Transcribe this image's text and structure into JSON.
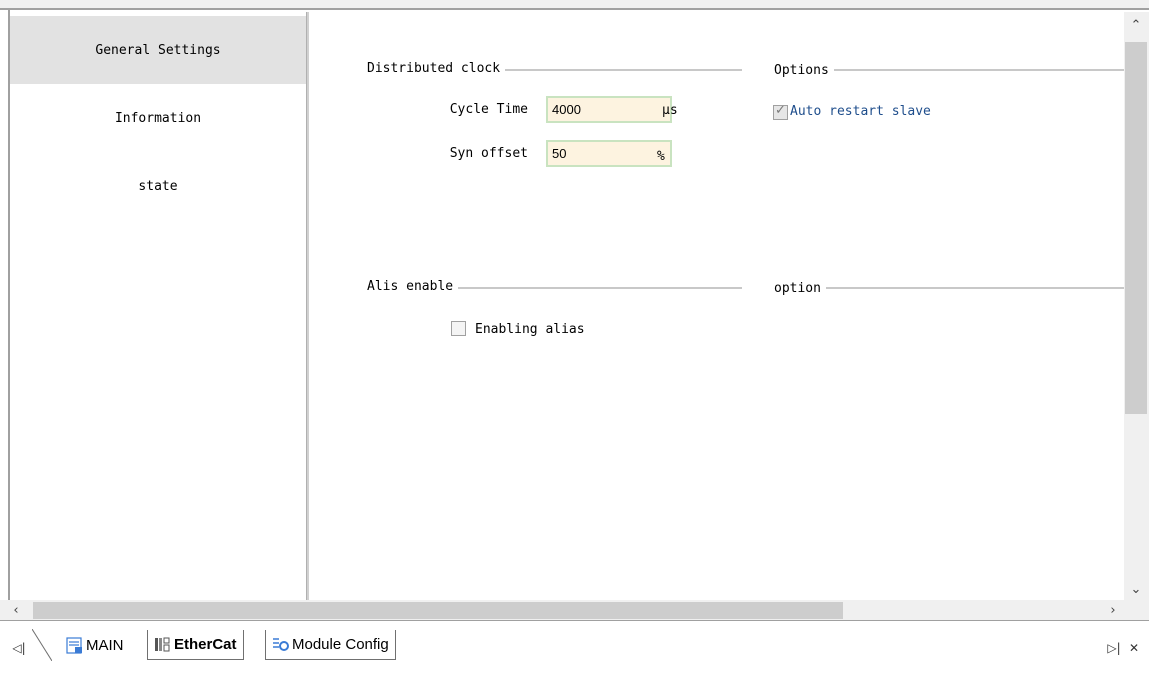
{
  "sidebar": {
    "items": [
      {
        "label": "General Settings",
        "active": true
      },
      {
        "label": "Information",
        "active": false
      },
      {
        "label": "state",
        "active": false
      }
    ]
  },
  "distributed_clock": {
    "title": "Distributed clock",
    "cycle_time_label": "Cycle Time",
    "cycle_time_value": "4000",
    "cycle_time_unit": "μs",
    "syn_offset_label": "Syn offset",
    "syn_offset_value": "50",
    "syn_offset_unit": "%"
  },
  "options": {
    "title": "Options",
    "auto_restart_label": "Auto restart slave",
    "auto_restart_checked": true
  },
  "alias": {
    "title": "Alis enable",
    "enabling_alias_label": "Enabling alias",
    "enabling_alias_checked": false
  },
  "option2": {
    "title": "option"
  },
  "tabs": [
    {
      "label": "MAIN",
      "icon": "program-icon",
      "active": false
    },
    {
      "label": "EtherCat",
      "icon": "ethercat-icon",
      "active": true
    },
    {
      "label": "Module Config",
      "icon": "module-config-icon",
      "active": false
    }
  ],
  "colors": {
    "input_bg": "#fdf3e0",
    "input_border": "#c9e3c0",
    "active_sidebar": "#e2e2e2",
    "checkbox_label_blue": "#1f4e8c"
  }
}
